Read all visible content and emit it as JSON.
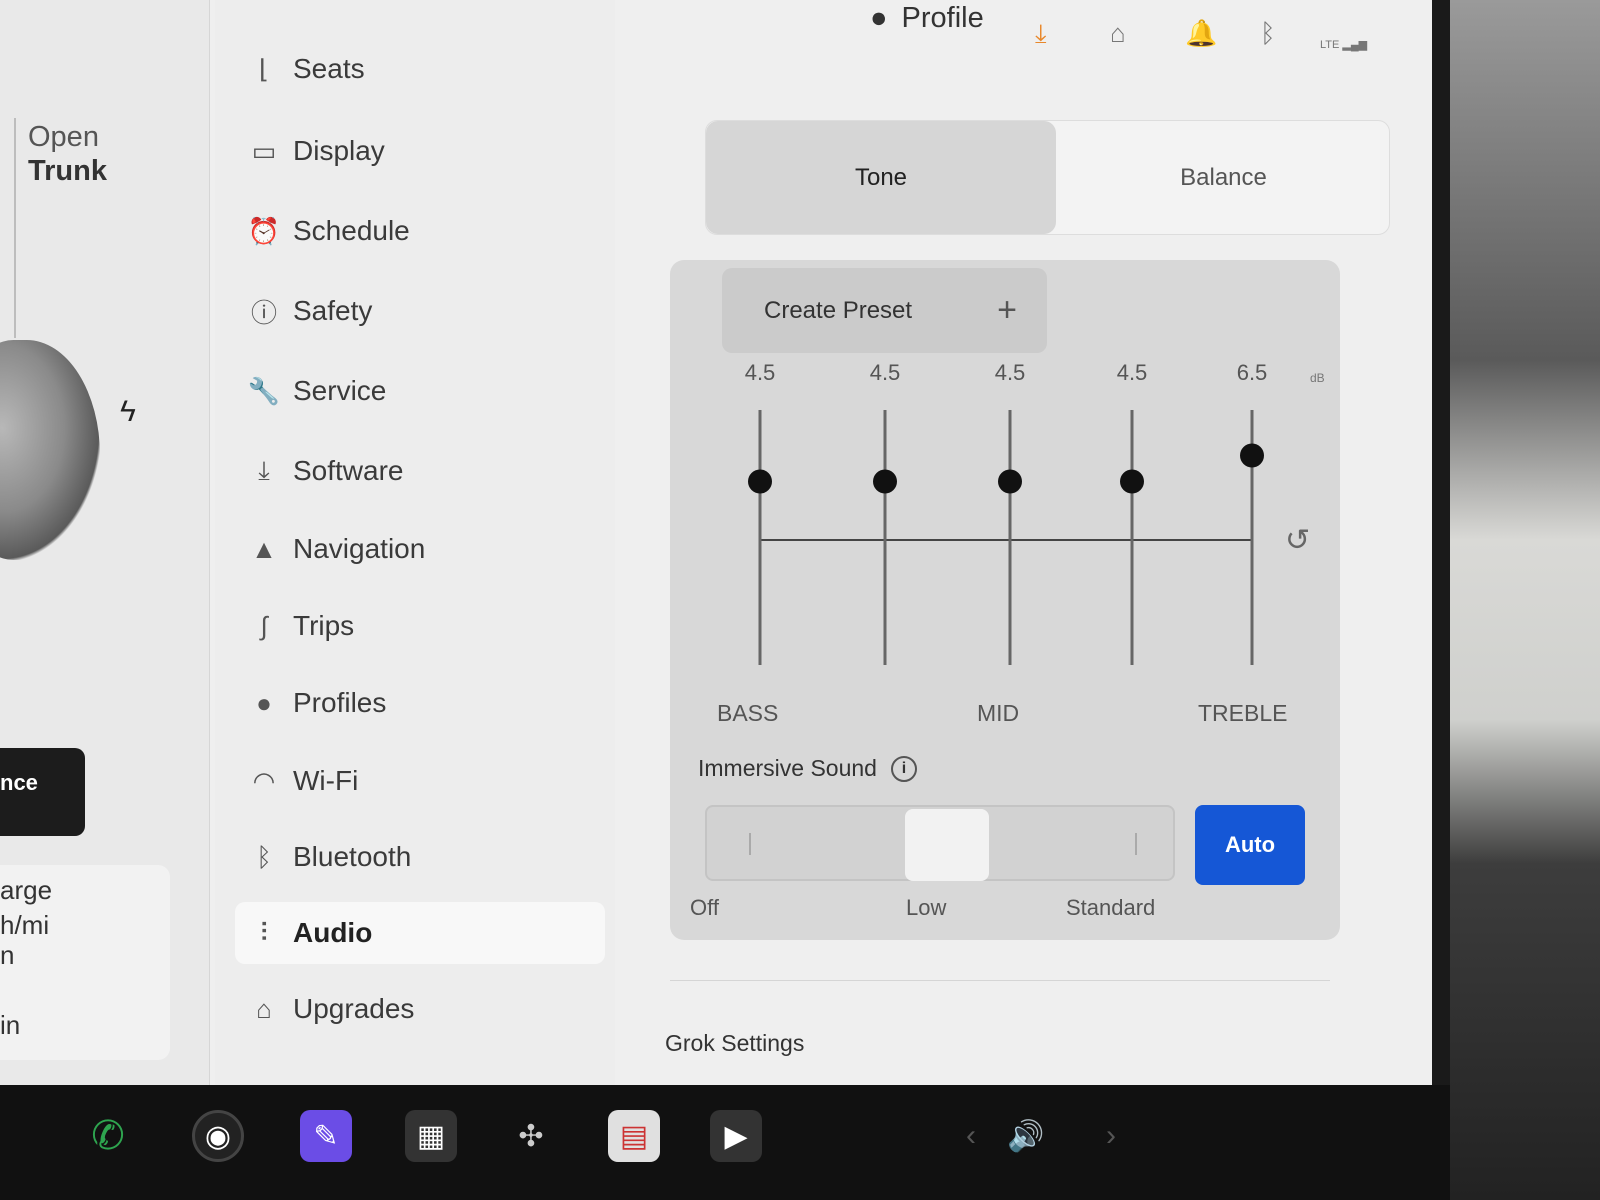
{
  "car_panel": {
    "open_trunk_line1": "Open",
    "open_trunk_line2": "Trunk",
    "dark_button_label": "nce",
    "charge_line1": "arge",
    "charge_line2": "h/mi",
    "charge_line3": "n",
    "charge_line4": "in"
  },
  "status_bar": {
    "profile_label": "Profile",
    "lte_label": "LTE"
  },
  "menu": {
    "items": [
      {
        "label": "Seats",
        "icon": "seat-icon"
      },
      {
        "label": "Display",
        "icon": "display-icon"
      },
      {
        "label": "Schedule",
        "icon": "alarm-icon"
      },
      {
        "label": "Safety",
        "icon": "alert-icon"
      },
      {
        "label": "Service",
        "icon": "wrench-icon"
      },
      {
        "label": "Software",
        "icon": "download-icon"
      },
      {
        "label": "Navigation",
        "icon": "navigation-icon"
      },
      {
        "label": "Trips",
        "icon": "trips-icon"
      },
      {
        "label": "Profiles",
        "icon": "person-icon"
      },
      {
        "label": "Wi-Fi",
        "icon": "wifi-icon"
      },
      {
        "label": "Bluetooth",
        "icon": "bluetooth-icon"
      },
      {
        "label": "Audio",
        "icon": "sliders-icon",
        "active": true
      },
      {
        "label": "Upgrades",
        "icon": "bag-icon"
      }
    ]
  },
  "audio": {
    "tabs": [
      "Tone",
      "Balance"
    ],
    "active_tab": "Tone",
    "create_preset_label": "Create Preset",
    "eq_values": [
      "4.5",
      "4.5",
      "4.5",
      "4.5",
      "6.5"
    ],
    "eq_levels": [
      4.5,
      4.5,
      4.5,
      4.5,
      6.5
    ],
    "eq_unit": "dB",
    "band_labels": {
      "bass": "BASS",
      "mid": "MID",
      "treble": "TREBLE"
    },
    "immersive_label": "Immersive Sound",
    "immersive_options": [
      "Off",
      "Low",
      "Standard"
    ],
    "immersive_selected": "Low",
    "auto_label": "Auto",
    "grok_settings_label": "Grok Settings"
  },
  "colors": {
    "accent_blue": "#1557d6",
    "download_orange": "#e8872a",
    "phone_green": "#2ea44f"
  }
}
